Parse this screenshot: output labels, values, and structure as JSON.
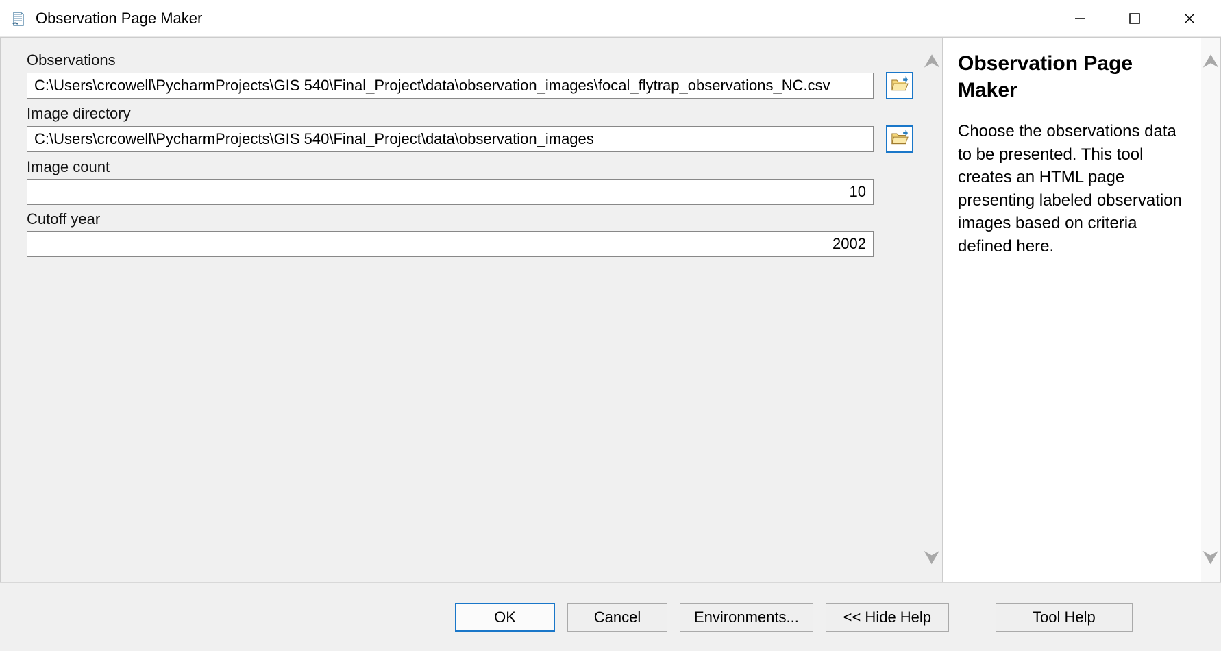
{
  "window": {
    "title": "Observation Page Maker"
  },
  "form": {
    "observations": {
      "label": "Observations",
      "value": "C:\\Users\\crcowell\\PycharmProjects\\GIS 540\\Final_Project\\data\\observation_images\\focal_flytrap_observations_NC.csv"
    },
    "image_directory": {
      "label": "Image directory",
      "value": "C:\\Users\\crcowell\\PycharmProjects\\GIS 540\\Final_Project\\data\\observation_images"
    },
    "image_count": {
      "label": "Image count",
      "value": "10"
    },
    "cutoff_year": {
      "label": "Cutoff year",
      "value": "2002"
    }
  },
  "help": {
    "title": "Observation Page Maker",
    "text": "Choose the observations data to be presented. This tool creates an HTML page presenting labeled observation images based on criteria defined here."
  },
  "buttons": {
    "ok": "OK",
    "cancel": "Cancel",
    "environments": "Environments...",
    "hide_help": "<< Hide Help",
    "tool_help": "Tool Help"
  }
}
